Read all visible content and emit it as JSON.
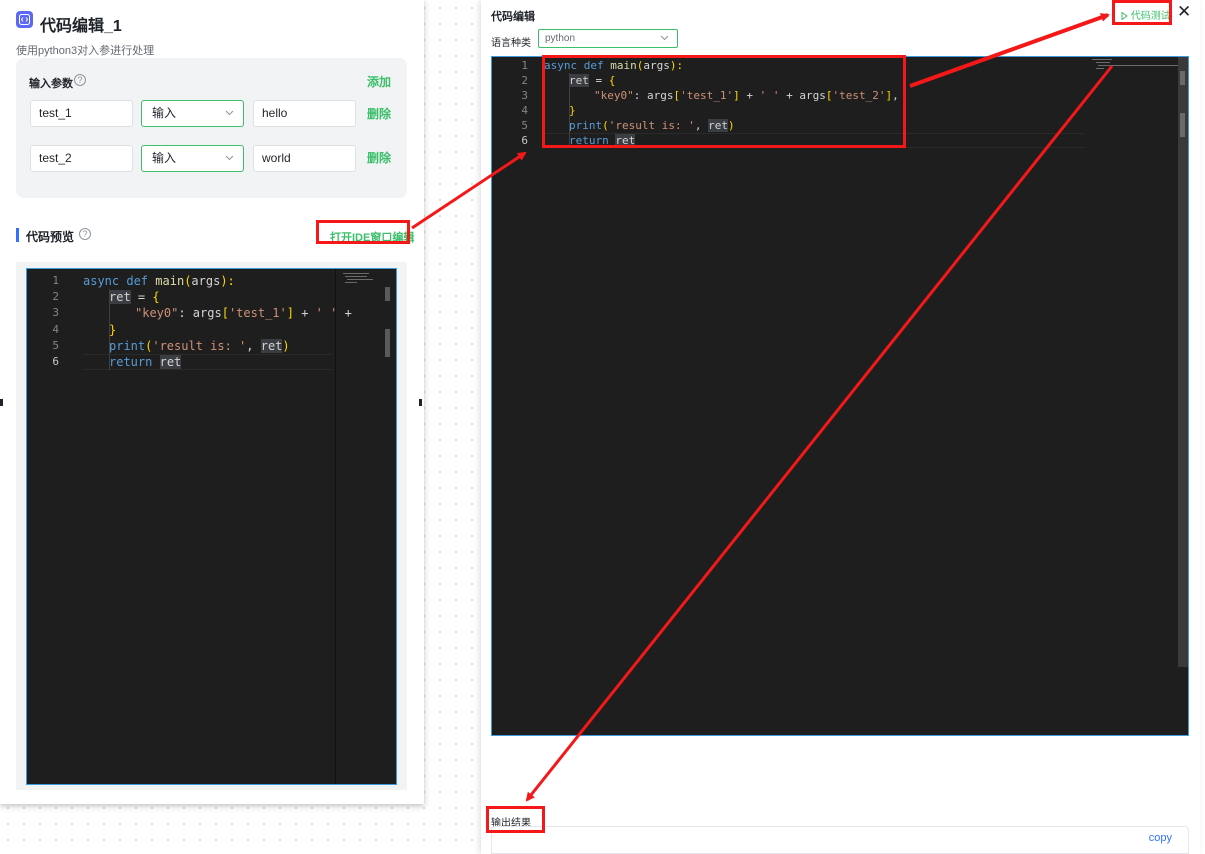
{
  "node": {
    "title": "代码编辑_1",
    "description": "使用python3对入参进行处理",
    "icon": "code-icon",
    "accent_color": "#5b68f5"
  },
  "input_params": {
    "title": "输入参数",
    "help_icon": "question-icon",
    "add_label": "添加",
    "rows": [
      {
        "name": "test_1",
        "type": "输入",
        "value": "hello",
        "delete_label": "删除"
      },
      {
        "name": "test_2",
        "type": "输入",
        "value": "world",
        "delete_label": "删除"
      }
    ]
  },
  "code_preview": {
    "title": "代码预览",
    "help_icon": "question-icon",
    "open_ide_label": "打开IDE窗口编辑"
  },
  "code": {
    "line_numbers": [
      "1",
      "2",
      "3",
      "4",
      "5",
      "6"
    ],
    "active_line": "6",
    "lines": {
      "l1_kw1": "async",
      "l1_kw2": "def",
      "l1_fn": "main",
      "l1_open": "(",
      "l1_arg": "args",
      "l1_close": "):",
      "l2_var": "ret",
      "l2_eq": " = ",
      "l2_brace": "{",
      "l3_key": "\"key0\"",
      "l3_colon": ": args",
      "l3_b1": "[",
      "l3_s1": "'test_1'",
      "l3_b1c": "]",
      "l3_plus1": " + ",
      "l3_space": "' '",
      "l3_plus2": " + args",
      "l3_b2": "[",
      "l3_s2": "'test_2'",
      "l3_b2c": "]",
      "l3_end": ",",
      "l4_brace": "}",
      "l5_fn": "print",
      "l5_open": "(",
      "l5_str": "'result is: '",
      "l5_comma": ", ",
      "l5_var": "ret",
      "l5_close": ")",
      "l6_kw": "return",
      "l6_var": "ret"
    },
    "preview_l3_truncated": "+"
  },
  "dialog": {
    "title": "代码编辑",
    "language_label": "语言种类",
    "language_value": "python",
    "run_label": "代码测试",
    "run_icon": "play-icon",
    "close_icon": "close-icon",
    "output_label": "输出结果",
    "copy_label": "copy"
  },
  "colors": {
    "green": "#3bbf6a",
    "editor_bg": "#1e1e1e",
    "annotation_red": "#f51818",
    "blue": "#3370ff"
  }
}
